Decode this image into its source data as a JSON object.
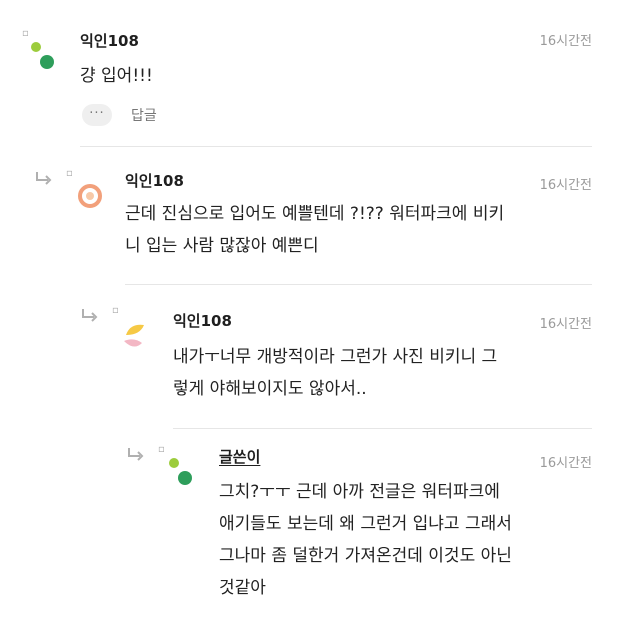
{
  "comments": [
    {
      "author": "익인108",
      "time": "16시간전",
      "lines": [
        "걍 입어!!!"
      ],
      "more_label": "···",
      "reply_label": "답글"
    },
    {
      "author": "익인108",
      "time": "16시간전",
      "lines": [
        "근데 진심으로 입어도 예쁠텐데 ?!?? 워터파크에 비키",
        "니 입는 사람 많잖아 예쁜디"
      ]
    },
    {
      "author": "익인108",
      "time": "16시간전",
      "lines": [
        "내가ㅜ너무 개방적이라 그런가 사진 비키니 그",
        "렇게 야해보이지도 않아서.."
      ]
    },
    {
      "author": "글쓴이",
      "time": "16시간전",
      "lines": [
        "그치?ㅜㅜ 근데 아까 전글은 워터파크에",
        "애기들도 보는데 왜 그런거 입냐고 그래서",
        "그나마 좀 덜한거 가져온건데 이것도 아닌",
        "것같아"
      ]
    }
  ],
  "colors": {
    "divider": "#e6e6e6",
    "timestamp": "#9a9a9a",
    "avatar_green_light": "#9ccc3c",
    "avatar_green_dark": "#2e9e5b",
    "avatar_orange": "#f2a07b",
    "avatar_yellow": "#f6c945",
    "avatar_pink": "#f3b7c4"
  },
  "icons": [
    "reply-arrow-icon",
    "more-dots-icon",
    "avatar-dots-icon",
    "avatar-ring-icon",
    "avatar-petal-icon"
  ]
}
